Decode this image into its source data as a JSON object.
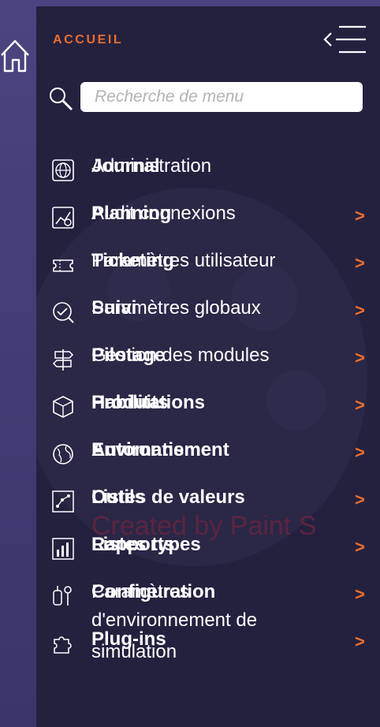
{
  "header": {
    "title": "ACCUEIL",
    "collapse_icon": "collapse-menu-icon",
    "home_icon": "home-icon"
  },
  "search": {
    "placeholder": "Recherche de menu",
    "value": "",
    "icon": "search-icon"
  },
  "watermark_text": "Created by Paint S",
  "colors": {
    "accent": "#ec6e2e",
    "panel": "#24213f",
    "background": "#3b3769"
  },
  "menu": {
    "items": [
      {
        "icon": "globe-icon",
        "label_primary": "Journal",
        "label_secondary": "Administration",
        "chevron": ""
      },
      {
        "icon": "dashboard-icon",
        "label_primary": "Planning",
        "label_secondary": "Audit connexions",
        "chevron": ">"
      },
      {
        "icon": "ticket-icon",
        "label_primary": "Ticketing",
        "label_secondary": "Paramètres utilisateur",
        "chevron": ">"
      },
      {
        "icon": "survey-icon",
        "label_primary": "Suivi",
        "label_secondary": "Paramètres globaux",
        "chevron": ">"
      },
      {
        "icon": "signpost-icon",
        "label_primary": "Pilotage",
        "label_secondary": "Gestion des modules",
        "chevron": ">"
      },
      {
        "icon": "box-icon",
        "label_primary": "Produits",
        "label_secondary": "Habilitations",
        "chevron": ">"
      },
      {
        "icon": "earth-icon",
        "label_primary": "Automatisme",
        "label_secondary": "Environnement",
        "chevron": ">"
      },
      {
        "icon": "graph-icon",
        "label_primary": "Outils",
        "label_secondary": "Listes de valeurs",
        "chevron": ">"
      },
      {
        "icon": "report-icon",
        "label_primary": "Rapports",
        "label_secondary": "Listes types",
        "chevron": ">"
      },
      {
        "icon": "tools-icon",
        "label_primary": "Configuration",
        "label_secondary": "Paramètres",
        "chevron": ">"
      },
      {
        "icon": "puzzle-icon",
        "label_primary": "Plug-ins",
        "label_secondary": "d'environnement de simulation",
        "chevron": ">"
      }
    ]
  }
}
